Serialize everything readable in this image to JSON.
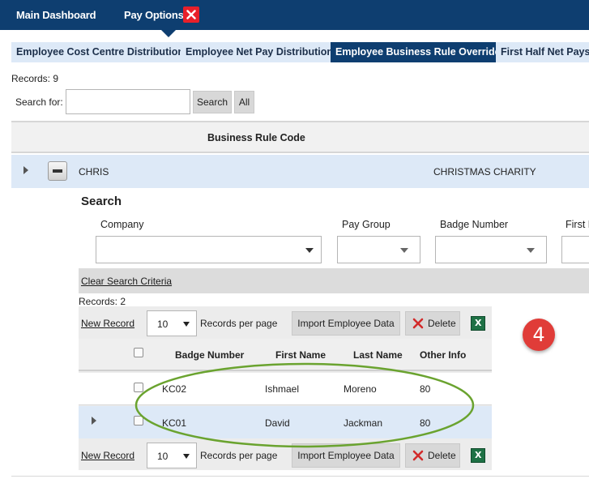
{
  "topbar": {
    "main_dashboard": "Main Dashboard",
    "pay_options": "Pay Options",
    "close_icon": "close-icon"
  },
  "tabs": [
    {
      "label": "Employee Cost Centre Distribution",
      "active": false
    },
    {
      "label": "Employee Net Pay Distribution",
      "active": false
    },
    {
      "label": "Employee Business Rule Override",
      "active": true
    },
    {
      "label": "First Half Net Pays",
      "active": false
    }
  ],
  "outer": {
    "records_label": "Records:",
    "records_count": "9",
    "search_for_label": "Search for:",
    "search_value": "",
    "search_button": "Search",
    "all_button": "All",
    "column_header": "Business Rule Code",
    "row": {
      "code": "CHRIS",
      "description": "CHRISTMAS CHARITY"
    }
  },
  "search_panel": {
    "title": "Search",
    "fields": {
      "company": {
        "label": "Company",
        "value": ""
      },
      "pay_group": {
        "label": "Pay Group",
        "value": ""
      },
      "badge_number": {
        "label": "Badge Number",
        "value": ""
      },
      "first_name": {
        "label": "First N",
        "value": ""
      }
    },
    "clear_link": "Clear Search Criteria"
  },
  "inner": {
    "records_label": "Records:",
    "records_count": "2",
    "new_record": "New Record",
    "page_size": "10",
    "records_per_page": "Records per page",
    "import_button": "Import Employee Data",
    "delete_button": "Delete",
    "export_icon": "excel-icon",
    "columns": [
      "Badge Number",
      "First Name",
      "Last Name",
      "Other Info"
    ],
    "rows": [
      {
        "badge": "KC02",
        "first": "Ishmael",
        "last": "Moreno",
        "other": "80"
      },
      {
        "badge": "KC01",
        "first": "David",
        "last": "Jackman",
        "other": "80"
      }
    ]
  },
  "annotation": {
    "step": "4",
    "color": "#e03c38",
    "highlight_color": "#6aa32f"
  },
  "colors": {
    "nav": "#0e3e70",
    "tab": "#dde9f7",
    "row_selected": "#dde9f7"
  }
}
